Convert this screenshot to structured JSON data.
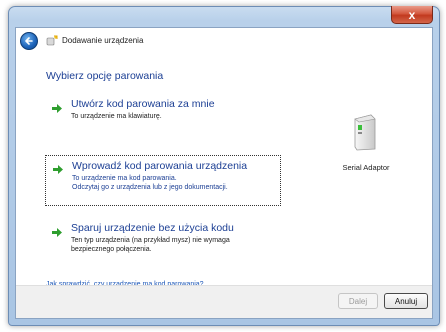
{
  "window": {
    "title": "Dodawanie urządzenia",
    "close_glyph": "x"
  },
  "main": {
    "heading": "Wybierz opcję parowania",
    "options": [
      {
        "title": "Utwórz kod parowania za mnie",
        "description_lines": [
          "To urządzenie ma klawiaturę."
        ],
        "selected": false
      },
      {
        "title": "Wprowadź kod parowania urządzenia",
        "description_lines": [
          "To urządzenie ma kod parowania.",
          "Odczytaj go z urządzenia lub z jego dokumentacji."
        ],
        "selected": true
      },
      {
        "title": "Sparuj urządzenie bez użycia kodu",
        "description_lines": [
          "Ten typ urządzenia (na przykład mysz) nie wymaga",
          "bezpiecznego połączenia."
        ],
        "selected": false
      }
    ],
    "device": {
      "label": "Serial Adaptor",
      "icon": "serial-adaptor-icon"
    },
    "help_link": "Jak sprawdzić, czy urządzenie ma kod parowania?"
  },
  "footer": {
    "next_label": "Dalej",
    "cancel_label": "Anuluj"
  },
  "colors": {
    "heading": "#1c3f94",
    "arrow": "#2e9e2e",
    "link": "#1c57b8"
  }
}
